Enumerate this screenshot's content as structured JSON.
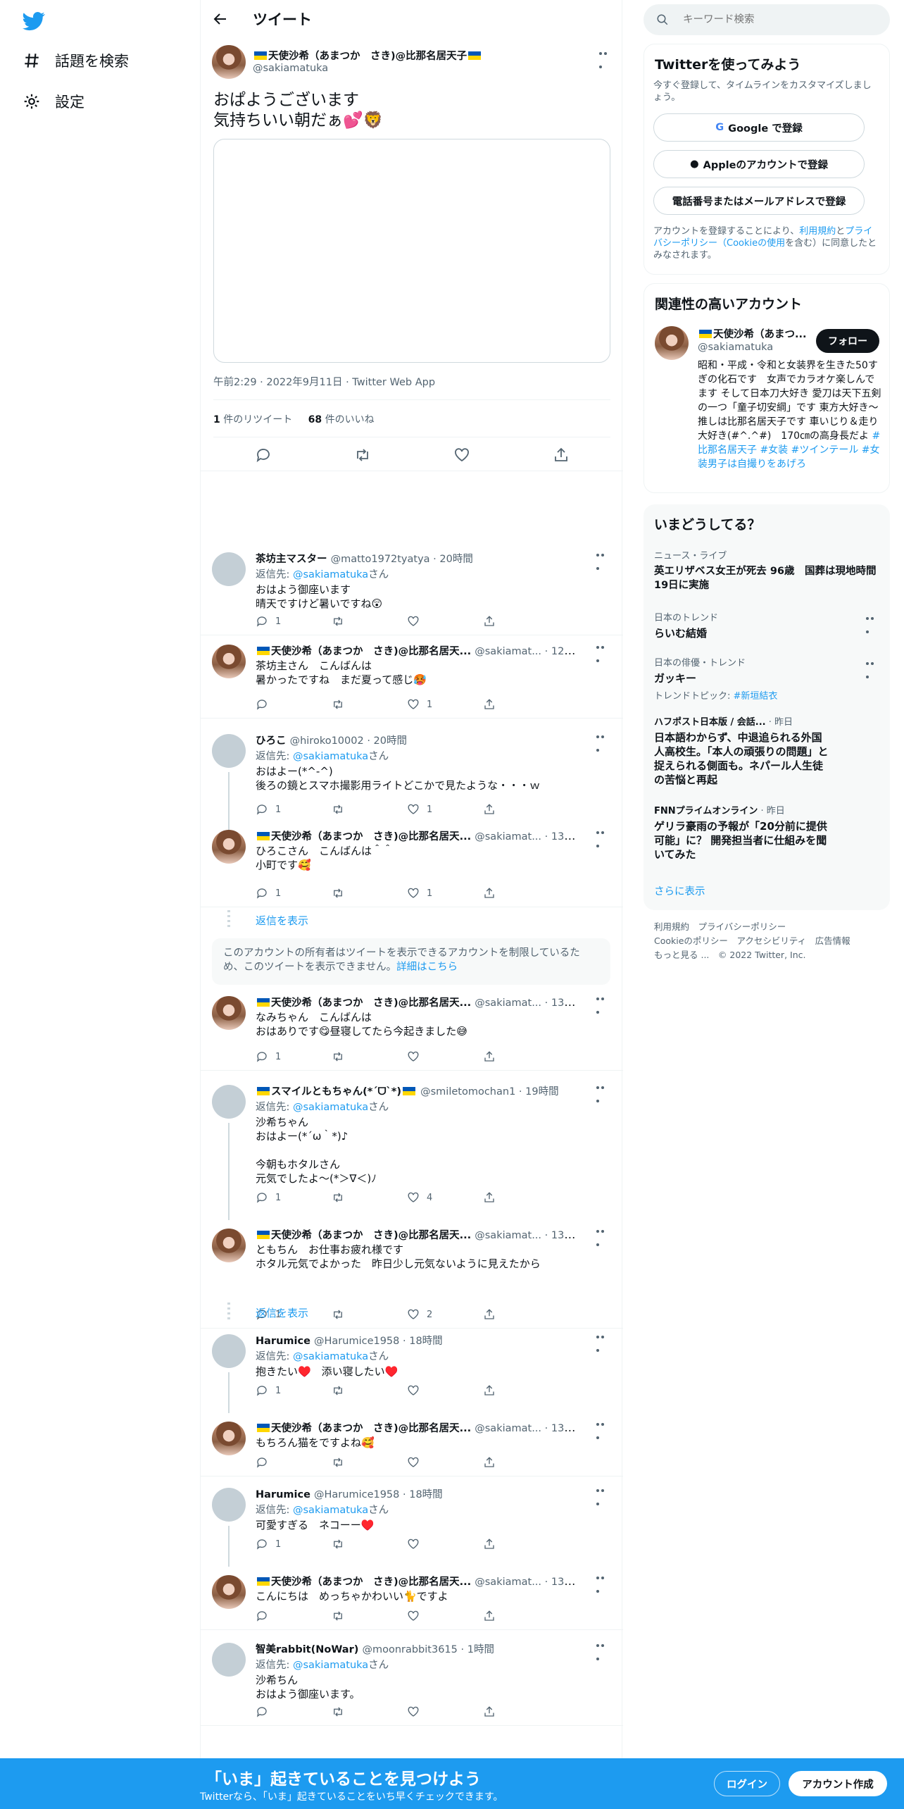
{
  "nav": {
    "explore": "話題を検索",
    "settings": "設定"
  },
  "header": {
    "title": "ツイート"
  },
  "main_tweet": {
    "name": "天使沙希（あまつか　さき)@比那名居天子",
    "handle": "@sakiamatuka",
    "text": "おぱようございます\n気持ちいい朝だぁ💕🦁",
    "meta": "午前2:29 · 2022年9月11日 · Twitter Web App",
    "retweets_num": "1",
    "retweets_label": " 件のリツイート",
    "likes_num": "68",
    "likes_label": " 件のいいね"
  },
  "replies": [
    {
      "name": "茶坊主マスター",
      "handle": "@matto1972tyatya",
      "time": " · 20時間",
      "replyto_label": "返信先: ",
      "replyto": "@sakiamatuka",
      "replyto_suffix": "さん",
      "text": "おはよう御座います\n晴天ですけど暑いですね😲",
      "reply_count": "1",
      "rt_count": "",
      "like_count": ""
    },
    {
      "name": "天使沙希（あまつか　さき)@比那名居天...",
      "handle": "@sakiamat...",
      "time": " · 12時間",
      "text": "茶坊主さん　こんばんは\n暑かったですね　まだ夏って感じ🥵",
      "reply_count": "",
      "rt_count": "",
      "like_count": "1"
    },
    {
      "name": "ひろこ",
      "handle": "@hiroko10002",
      "time": " · 20時間",
      "replyto_label": "返信先: ",
      "replyto": "@sakiamatuka",
      "replyto_suffix": "さん",
      "text": "おはよー(*^-^)\n後ろの鏡とスマホ撮影用ライトどこかで見たような・・・ｗ",
      "reply_count": "1",
      "rt_count": "",
      "like_count": "1"
    },
    {
      "name": "天使沙希（あまつか　さき)@比那名居天...",
      "handle": "@sakiamat...",
      "time": " · 13時間",
      "text": "ひろこさん　こんばんは＾＾\n小町です🥰",
      "reply_count": "1",
      "rt_count": "",
      "like_count": "1"
    },
    {
      "name": "天使沙希（あまつか　さき)@比那名居天...",
      "handle": "@sakiamat...",
      "time": " · 13時間",
      "text": "なみちゃん　こんばんは\nおはありです😋昼寝してたら今起きました😅",
      "reply_count": "1",
      "rt_count": "",
      "like_count": ""
    },
    {
      "name": "スマイルともちゃん(*ˊᗜˋ*)",
      "handle": "@smiletomochan1",
      "time": " · 19時間",
      "replyto_label": "返信先: ",
      "replyto": "@sakiamatuka",
      "replyto_suffix": "さん",
      "text": "沙希ちゃん\nおはよー(*´ω｀*)♪\n\n今朝もホタルさん\n元気でしたよ～(*＞∇＜)ﾉ",
      "reply_count": "1",
      "rt_count": "",
      "like_count": "4"
    },
    {
      "name": "天使沙希（あまつか　さき)@比那名居天...",
      "handle": "@sakiamat...",
      "time": " · 13時間",
      "text": "ともちん　お仕事お疲れ様です\nホタル元気でよかった　昨日少し元気ないように見えたから",
      "reply_count": "1",
      "rt_count": "",
      "like_count": "2"
    },
    {
      "name": "Harumice",
      "handle": "@Harumice1958",
      "time": " · 18時間",
      "replyto_label": "返信先: ",
      "replyto": "@sakiamatuka",
      "replyto_suffix": "さん",
      "text": "抱きたい♥️　添い寝したい♥️",
      "reply_count": "1",
      "rt_count": "",
      "like_count": ""
    },
    {
      "name": "天使沙希（あまつか　さき)@比那名居天...",
      "handle": "@sakiamat...",
      "time": " · 13時間",
      "text": "もちろん猫をですよね🥰",
      "reply_count": "",
      "rt_count": "",
      "like_count": ""
    },
    {
      "name": "Harumice",
      "handle": "@Harumice1958",
      "time": " · 18時間",
      "replyto_label": "返信先: ",
      "replyto": "@sakiamatuka",
      "replyto_suffix": "さん",
      "text": "可愛すぎる　ネコーー♥️",
      "reply_count": "1",
      "rt_count": "",
      "like_count": ""
    },
    {
      "name": "天使沙希（あまつか　さき)@比那名居天...",
      "handle": "@sakiamat...",
      "time": " · 13時間",
      "text": "こんにちは　めっちゃかわいい🐈ですよ",
      "reply_count": "",
      "rt_count": "",
      "like_count": ""
    },
    {
      "name": "智美rabbit(NoWar)",
      "handle": "@moonrabbit3615",
      "time": " · 1時間",
      "replyto_label": "返信先: ",
      "replyto": "@sakiamatuka",
      "replyto_suffix": "さん",
      "text": "沙希ちん\nおはよう御座います。",
      "reply_count": "",
      "rt_count": "",
      "like_count": ""
    }
  ],
  "show_replies": "返信を表示",
  "restricted": {
    "text": "このアカウントの所有者はツイートを表示できるアカウントを制限しているため、このツイートを表示できません。",
    "link": "詳細はこちら"
  },
  "search": {
    "placeholder": "キーワード検索"
  },
  "signup": {
    "title": "Twitterを使ってみよう",
    "sub": "今すぐ登録して、タイムラインをカスタマイズしましょう。",
    "google": "Google で登録",
    "apple": "Appleのアカウントで登録",
    "phone": "電話番号またはメールアドレスで登録",
    "terms_pre": "アカウントを登録することにより、",
    "terms_link1": "利用規約",
    "terms_mid": "と",
    "terms_link2": "プライバシーポリシー（Cookieの使用",
    "terms_post": "を含む）に同意したとみなされます。"
  },
  "related": {
    "title": "関連性の高いアカウント",
    "name": "天使沙希（あまつ...",
    "handle": "@sakiamatuka",
    "follow": "フォロー",
    "bio": "昭和・平成・令和と女装界を生きた50すぎの化石です　女声でカラオケ楽しんでます そして日本刀大好き 愛刀は天下五剣の一つ「童子切安綱」です 東方大好き～推しは比那名居天子です 車いじり＆走り大好き(#^.^#)　170㎝の高身長だよ ",
    "bio_tags": "#比那名居天子 #女装 #ツインテール #女装男子は自撮りをあげろ"
  },
  "trends": {
    "title": "いまどうしてる？",
    "items": [
      {
        "cat": "ニュース・ライブ",
        "title": "英エリザベス女王が死去 96歳　国葬は現地時間19日に実施"
      },
      {
        "cat": "日本のトレンド",
        "title": "らいむ結婚"
      },
      {
        "cat": "日本の俳優・トレンド",
        "title": "ガッキー",
        "sub_label": "トレンドトピック: ",
        "sub_tag": "#新垣結衣"
      },
      {
        "cat": "ハフポスト日本版 / 会話...",
        "cat_time": " · 昨日",
        "title": "日本語わからず、中退追られる外国人高校生。「本人の頑張りの問題」と捉えられる側面も。ネパール人生徒の苦悩と再起"
      },
      {
        "cat": "FNNプライムオンライン",
        "cat_time": " · 昨日",
        "title": "ゲリラ豪雨の予報が「20分前に提供可能」に？ 開発担当者に仕組みを聞いてみた"
      }
    ],
    "more": "さらに表示"
  },
  "footer": {
    "l1": "利用規約",
    "l2": "プライバシーポリシー",
    "l3": "Cookieのポリシー",
    "l4": "アクセシビリティ",
    "l5": "広告情報",
    "l6": "もっと見る ...",
    "l7": "© 2022 Twitter, Inc."
  },
  "banner": {
    "title": "「いま」起きていることを見つけよう",
    "sub": "Twitterなら、「いま」起きていることをいち早くチェックできます。",
    "login": "ログイン",
    "signup": "アカウント作成"
  },
  "colors": {
    "accent": "#1d9bf0",
    "text": "#0f1419",
    "secondary": "#536471"
  }
}
